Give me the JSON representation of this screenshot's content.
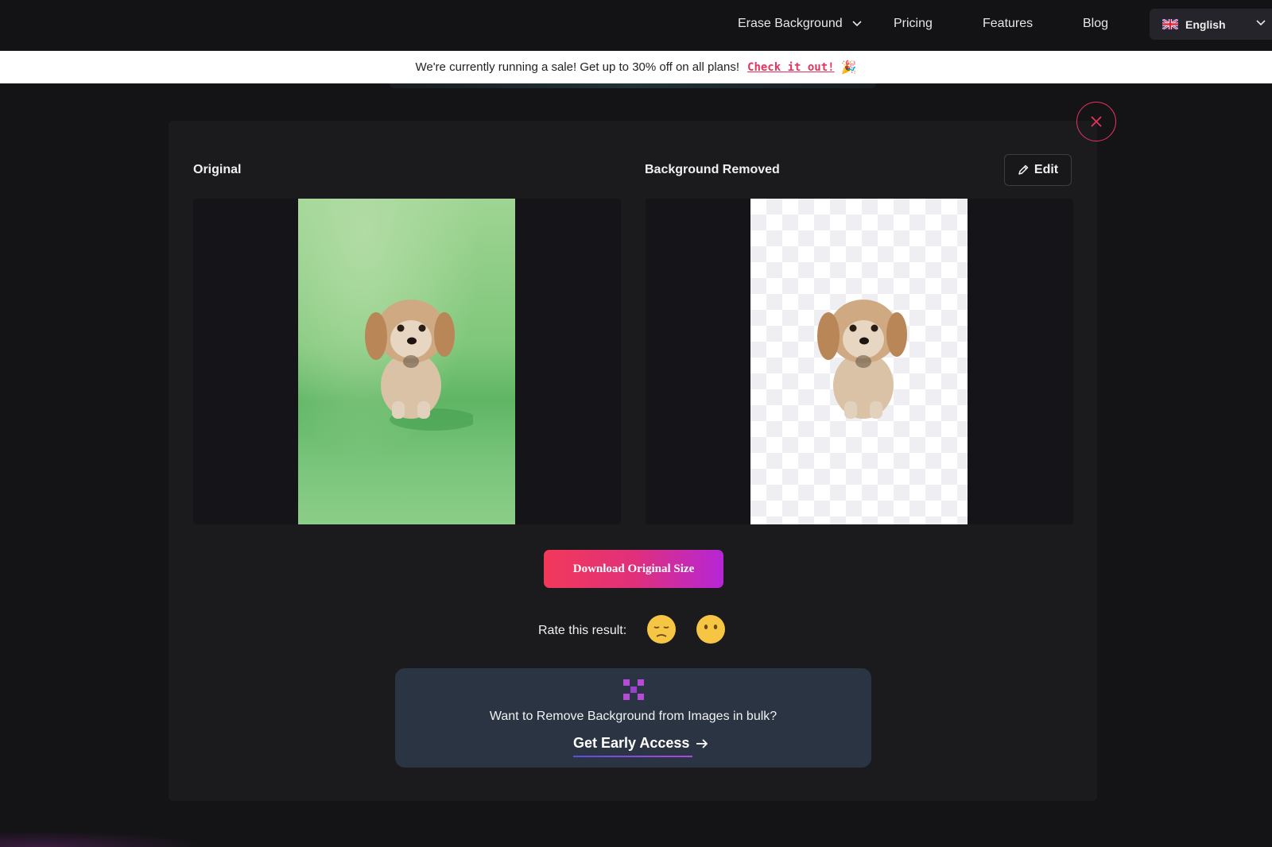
{
  "nav": {
    "erase_background": "Erase Background",
    "pricing": "Pricing",
    "features": "Features",
    "blog": "Blog",
    "language": "English"
  },
  "banner": {
    "text": "We're currently running a sale! Get up to 30% off on all plans!",
    "link": "Check it out!",
    "emoji": "🎉"
  },
  "result": {
    "original_label": "Original",
    "removed_label": "Background Removed",
    "edit_label": "Edit",
    "download_label": "Download Original Size",
    "rate_label": "Rate this result:",
    "emoji_sad": "😔",
    "emoji_neutral": "😶"
  },
  "bulk": {
    "text": "Want to Remove Background from Images in bulk?",
    "link": "Get Early Access"
  },
  "colors": {
    "accent": "#e8325e",
    "gradient_end": "#b526d6",
    "card_bg": "#2a3442"
  }
}
